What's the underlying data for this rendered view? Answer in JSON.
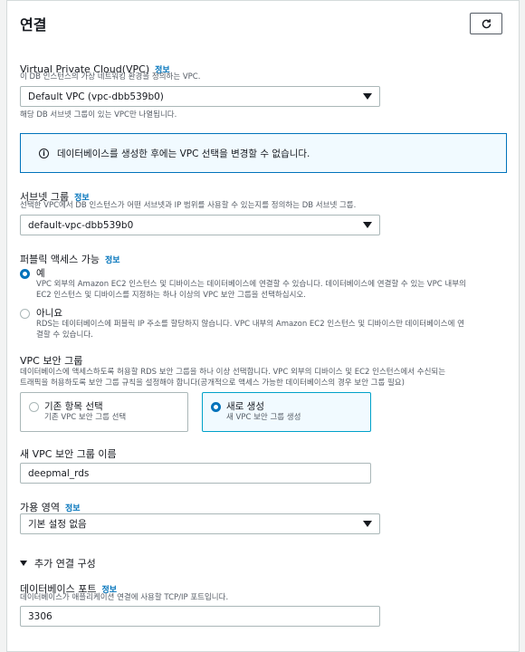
{
  "section": {
    "title": "연결",
    "refresh_icon": "refresh-icon"
  },
  "vpc": {
    "label": "Virtual Private Cloud(VPC)",
    "info": "정보",
    "description": "이 DB 인스턴스의 가상 네트워킹 환경을 정의하는 VPC.",
    "selected": "Default VPC (vpc-dbb539b0)",
    "hint": "해당 DB 서브넷 그룹이 있는 VPC만 나열됩니다."
  },
  "alert": {
    "text": "데이터베이스를 생성한 후에는 VPC 선택을 변경할 수 없습니다."
  },
  "subnet": {
    "label": "서브넷 그룹",
    "info": "정보",
    "description": "선택한 VPC에서 DB 인스턴스가 어떤 서브넷과 IP 범위를 사용할 수 있는지를 정의하는 DB 서브넷 그룹.",
    "selected": "default-vpc-dbb539b0"
  },
  "public_access": {
    "label": "퍼블릭 액세스 가능",
    "info": "정보",
    "options": [
      {
        "title": "예",
        "checked": true,
        "desc1": "VPC 외부의 Amazon EC2 인스턴스 및 디바이스는 데이터베이스에 연결할 수 있습니다. 데이터베이스에 연결할 수 있는 VPC 내부의",
        "desc2": "EC2 인스턴스 및 디바이스를 지정하는 하나 이상의 VPC 보안 그룹을 선택하십시오."
      },
      {
        "title": "아니요",
        "checked": false,
        "desc1": "RDS는 데이터베이스에 퍼블릭 IP 주소를 할당하지 않습니다. VPC 내부의 Amazon EC2 인스턴스 및 디바이스만 데이터베이스에 연",
        "desc2": "결할 수 있습니다."
      }
    ]
  },
  "security_group": {
    "label": "VPC 보안 그룹",
    "desc1": "데이터베이스에 액세스하도록 허용할 RDS 보안 그룹을 하나 이상 선택합니다. VPC 외부의 디바이스 및 EC2 인스턴스에서 수신되는",
    "desc2": "트래픽을 허용하도록 보안 그룹 규칙을 설정해야 합니다(공개적으로 액세스 가능한 데이터베이스의 경우 보안 그룹 필요)",
    "options": [
      {
        "title": "기존 항목 선택",
        "subtitle": "기존 VPC 보안 그룹 선택",
        "checked": false
      },
      {
        "title": "새로 생성",
        "subtitle": "새 VPC 보안 그룹 생성",
        "checked": true
      }
    ]
  },
  "new_sg_name": {
    "label": "새 VPC 보안 그룹 이름",
    "value": "deepmal_rds"
  },
  "availability_zone": {
    "label": "가용 영역",
    "info": "정보",
    "selected": "기본 설정 없음"
  },
  "additional": {
    "label": "추가 연결 구성"
  },
  "port": {
    "label": "데이터베이스 포트",
    "info": "정보",
    "description": "데이터베이스가 애플리케이션 연결에 사용할 TCP/IP 포트입니다.",
    "value": "3306"
  },
  "colors": {
    "accent": "#0073bb",
    "selected_tile_border": "#00a1c9",
    "selected_tile_bg": "#f1faff"
  }
}
